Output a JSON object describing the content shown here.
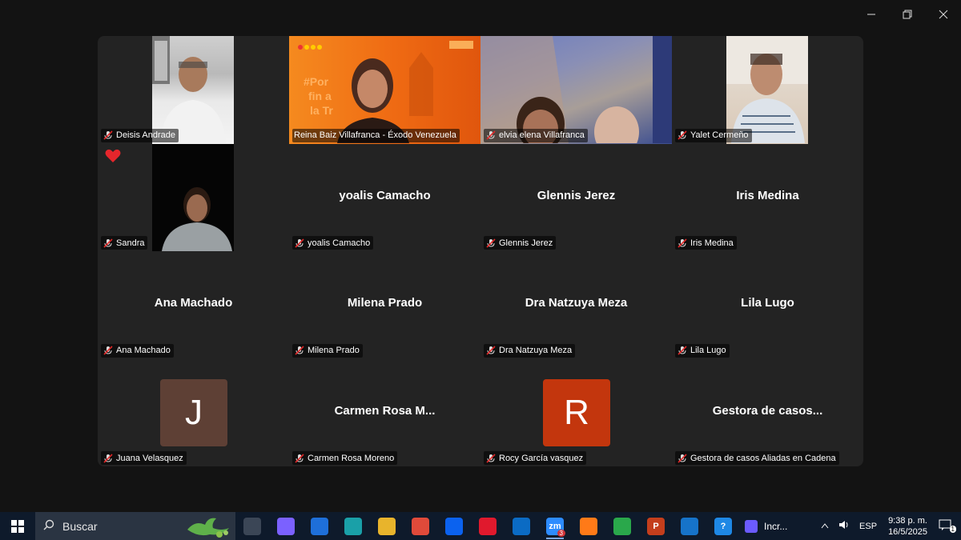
{
  "window": {
    "minimize_icon": "minimize-icon",
    "restore_icon": "restore-icon",
    "close_icon": "close-icon"
  },
  "participants": [
    {
      "name": "Deisis Andrade",
      "video": true,
      "muted": true
    },
    {
      "name": "Reina Baiz Villafranca - Éxodo Venezuela",
      "video": true,
      "muted": false,
      "speaking": true
    },
    {
      "name": "elvia elena Villafranca",
      "video": true,
      "muted": true
    },
    {
      "name": "Yalet Cermeño",
      "video": true,
      "muted": true
    },
    {
      "name": "Sandra",
      "video": true,
      "muted": true,
      "reaction": "heart"
    },
    {
      "name": "yoalis Camacho",
      "display": "yoalis Camacho",
      "video": false,
      "muted": true
    },
    {
      "name": "Glennis Jerez",
      "display": "Glennis Jerez",
      "video": false,
      "muted": true
    },
    {
      "name": "Iris Medina",
      "display": "Iris Medina",
      "video": false,
      "muted": true
    },
    {
      "name": "Ana Machado",
      "display": "Ana Machado",
      "video": false,
      "muted": true
    },
    {
      "name": "Milena Prado",
      "display": "Milena Prado",
      "video": false,
      "muted": true
    },
    {
      "name": "Dra Natzuya Meza",
      "display": "Dra Natzuya Meza",
      "video": false,
      "muted": true
    },
    {
      "name": "Lila Lugo",
      "display": "Lila Lugo",
      "video": false,
      "muted": true
    },
    {
      "name": "Juana Velasquez",
      "video": false,
      "muted": true,
      "avatar_letter": "J",
      "avatar_color": "#5e4035"
    },
    {
      "name": "Carmen Rosa Moreno",
      "display": "Carmen Rosa M...",
      "video": false,
      "muted": true
    },
    {
      "name": "Rocy García vasquez",
      "video": false,
      "muted": true,
      "avatar_letter": "R",
      "avatar_color": "#c3360d"
    },
    {
      "name": "Gestora de casos Aliadas en Cadena",
      "display": "Gestora de casos...",
      "video": false,
      "muted": true
    }
  ],
  "taskbar": {
    "search_placeholder": "Buscar",
    "apps": [
      {
        "name": "task-view",
        "label": "",
        "color": "#3b4656"
      },
      {
        "name": "copilot",
        "label": "",
        "color": "#7b61ff"
      },
      {
        "name": "microsoft-store",
        "label": "",
        "color": "#1e6fd9"
      },
      {
        "name": "edge",
        "label": "",
        "color": "#1aa0a8"
      },
      {
        "name": "file-explorer",
        "label": "",
        "color": "#e8b42c"
      },
      {
        "name": "chrome",
        "label": "",
        "color": "#e04a3a"
      },
      {
        "name": "dropbox",
        "label": "",
        "color": "#0b62ef"
      },
      {
        "name": "opera",
        "label": "",
        "color": "#e0192d"
      },
      {
        "name": "outlook",
        "label": "",
        "color": "#0b6bc4"
      },
      {
        "name": "zoom",
        "label": "zm",
        "color": "#2d8cff",
        "badge": "3"
      },
      {
        "name": "firefox",
        "label": "",
        "color": "#ff7a18"
      },
      {
        "name": "evernote-app",
        "label": "",
        "color": "#2aa84b"
      },
      {
        "name": "powerpoint",
        "label": "P",
        "color": "#c43e1c"
      },
      {
        "name": "media-player",
        "label": "",
        "color": "#1673c9"
      },
      {
        "name": "help",
        "label": "?",
        "color": "#1e88e5"
      }
    ],
    "running_app_label": "Incr...",
    "language": "ESP",
    "time": "9:38 p. m.",
    "date": "16/5/2025",
    "notification_count": "1"
  }
}
